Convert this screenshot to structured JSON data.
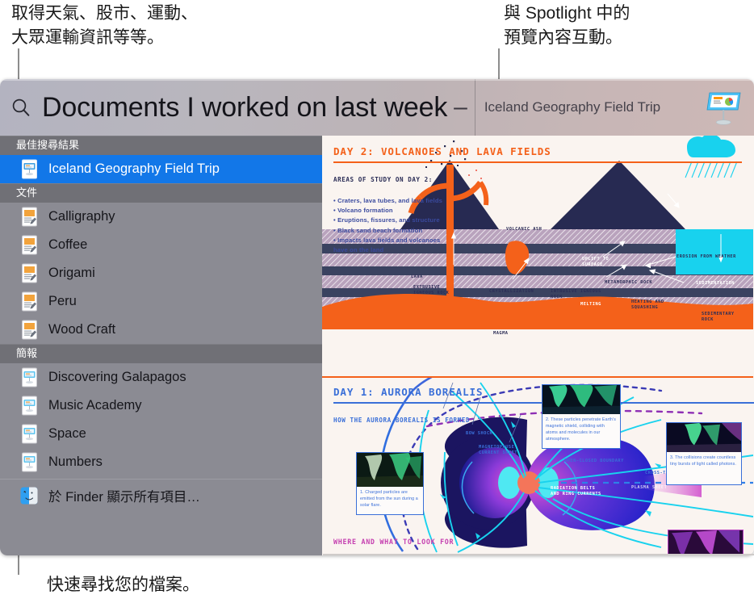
{
  "annotations": {
    "left": "取得天氣、股市、運動、\n大眾運輸資訊等等。",
    "right": "與 Spotlight 中的\n預覽內容互動。",
    "bottom": "快速尋找您的檔案。"
  },
  "search": {
    "icon": "search-icon",
    "query": "Documents I worked on last week",
    "dash": "–",
    "completion": "Iceland Geography Field Trip",
    "thumbnail_icon": "keynote-presentation-icon"
  },
  "results": {
    "groups": [
      {
        "header": "最佳搜尋結果",
        "items": [
          {
            "label": "Iceland Geography Field Trip",
            "icon": "keynote-document-icon",
            "selected": true
          }
        ]
      },
      {
        "header": "文件",
        "items": [
          {
            "label": "Calligraphy",
            "icon": "pages-document-icon",
            "selected": false
          },
          {
            "label": "Coffee",
            "icon": "pages-document-icon",
            "selected": false
          },
          {
            "label": "Origami",
            "icon": "pages-document-icon",
            "selected": false
          },
          {
            "label": "Peru",
            "icon": "pages-document-icon",
            "selected": false
          },
          {
            "label": "Wood Craft",
            "icon": "pages-document-icon",
            "selected": false
          }
        ]
      },
      {
        "header": "簡報",
        "items": [
          {
            "label": "Discovering Galapagos",
            "icon": "keynote-document-icon",
            "selected": false
          },
          {
            "label": "Music Academy",
            "icon": "keynote-document-icon",
            "selected": false
          },
          {
            "label": "Space",
            "icon": "keynote-document-icon",
            "selected": false
          },
          {
            "label": "Numbers",
            "icon": "keynote-document-icon",
            "selected": false
          }
        ]
      }
    ],
    "footer": {
      "label": "於 Finder 顯示所有項目…",
      "icon": "finder-icon"
    }
  },
  "preview": {
    "day2": {
      "title": "DAY 2: VOLCANOES AND LAVA FIELDS",
      "subtitle": "AREAS OF STUDY ON DAY 2:",
      "bullets": [
        "• Craters, lava tubes, and lava fields",
        "• Volcano formation",
        "• Eruptions, fissures, and structure",
        "• Black sand beach formation",
        "• Impacts lava fields and volcanoes",
        "   have on the land"
      ],
      "diagram_labels": [
        "VOLCANIC ASH",
        "LAVA",
        "EXTRUSIVE\nIGNEOUS ROCK",
        "CRYSTALLIZATION",
        "INTRUSIVE IGNEOUS\nROCK",
        "MAGMA",
        "UPLIFT TO\nSURFACE",
        "METAMORPHIC ROCK",
        "MELTING",
        "HEATING AND\nSQUASHING",
        "EROSION FROM WEATHER",
        "SEDIMENTATION",
        "SEDIMENTARY\nROCK"
      ]
    },
    "day1": {
      "title": "DAY 1: AURORA BOREALIS",
      "subtitle": "HOW THE AURORA BOREALIS IS FORMED",
      "footer_note": "WHERE AND WHAT TO LOOK FOR",
      "diagram_labels": [
        "BOW SHOCK",
        "MAGNETOPAUSE\nCURRENT SHEET",
        "OPEN-CLOSED BOUNDARY",
        "RADIATION BELTS\nAND RING CURRENTS",
        "CROSS-TAILED SHEET",
        "PLASMA SHEET"
      ],
      "cards": [
        {
          "id": 1,
          "caption": "1. Charged particles are emitted from the sun during a solar flare."
        },
        {
          "id": 2,
          "caption": "2. These particles penetrate Earth's magnetic shield, colliding with atoms and molecules in our atmosphere."
        },
        {
          "id": 3,
          "caption": "3. The collisions create countless tiny bursts of light called photons."
        }
      ]
    }
  },
  "colors": {
    "selection_blue": "#1277e8",
    "orange": "#f4611a",
    "navy": "#2b2d56",
    "blue": "#3a6fd8",
    "cyan": "#18d2ee",
    "magenta": "#b83fc0",
    "paper": "#faf4f0"
  }
}
